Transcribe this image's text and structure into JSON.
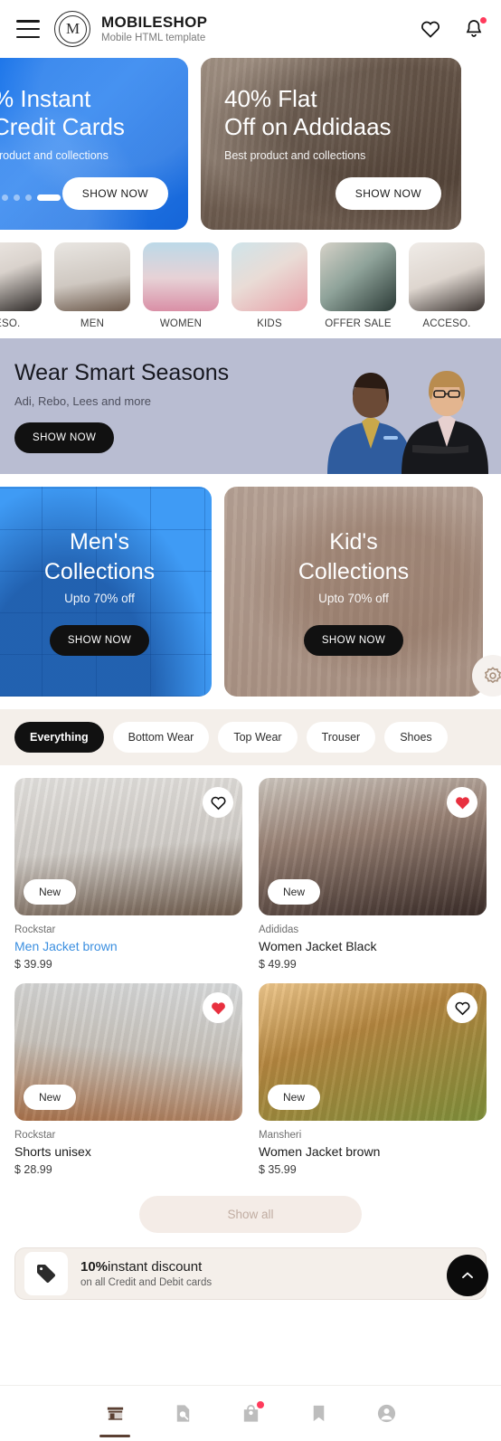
{
  "header": {
    "menu_icon": "hamburger-menu-icon",
    "logo_monogram": "M",
    "title": "MOBILESHOP",
    "subtitle": "Mobile HTML template",
    "wishlist_icon": "heart-icon",
    "notification_icon": "bell-icon",
    "notification_has_badge": true
  },
  "hero": {
    "slides": [
      {
        "title_line1": "% Instant",
        "title_line2": "Credit Cards",
        "subtitle": "product and collections",
        "button": "SHOW NOW",
        "theme": "blue"
      },
      {
        "title_line1": "40% Flat",
        "title_line2": "Off on Addidaas",
        "subtitle": "Best product and collections",
        "button": "SHOW NOW",
        "theme": "tan"
      }
    ],
    "dots_total": 4,
    "dots_active_index": 3
  },
  "categories": [
    {
      "label": "CESO.",
      "image": "accessories-thumb"
    },
    {
      "label": "MEN",
      "image": "men-thumb"
    },
    {
      "label": "WOMEN",
      "image": "women-thumb"
    },
    {
      "label": "KIDS",
      "image": "kids-thumb"
    },
    {
      "label": "OFFER SALE",
      "image": "offer-sale-thumb"
    },
    {
      "label": "ACCESO.",
      "image": "accessories-thumb-2"
    }
  ],
  "wide_banner": {
    "title": "Wear Smart Seasons",
    "subtitle": "Adi, Rebo, Lees and more",
    "button": "SHOW NOW",
    "bg_color": "#b9bdd2"
  },
  "collections": [
    {
      "title_line1": "Men's",
      "title_line2": "Collections",
      "subtitle": "Upto 70% off",
      "button": "SHOW NOW",
      "theme": "blue"
    },
    {
      "title_line1": "Kid's",
      "title_line2": "Collections",
      "subtitle": "Upto 70% off",
      "button": "SHOW NOW",
      "theme": "tan"
    }
  ],
  "settings_fab_icon": "gear-icon",
  "filters": {
    "chips": [
      "Everything",
      "Bottom Wear",
      "Top Wear",
      "Trouser",
      "Shoes"
    ],
    "active_index": 0,
    "bg_color": "#f4efea"
  },
  "products": [
    {
      "brand": "Rockstar",
      "name": "Men Jacket brown",
      "price": "$ 39.99",
      "badge": "New",
      "favorited": false,
      "name_highlighted": true
    },
    {
      "brand": "Adididas",
      "name": "Women Jacket Black",
      "price": "$ 49.99",
      "badge": "New",
      "favorited": true,
      "name_highlighted": false
    },
    {
      "brand": "Rockstar",
      "name": "Shorts unisex",
      "price": "$ 28.99",
      "badge": "New",
      "favorited": true,
      "name_highlighted": false
    },
    {
      "brand": "Mansheri",
      "name": "Women Jacket brown",
      "price": "$ 35.99",
      "badge": "New",
      "favorited": false,
      "name_highlighted": false
    }
  ],
  "show_all": {
    "label": "Show all"
  },
  "promo": {
    "icon": "price-tag-icon",
    "percent": "10%",
    "title_rest": "instant discount",
    "subtitle": "on all Credit and Debit cards"
  },
  "scroll_top_fab": {
    "icon": "chevron-up-icon"
  },
  "bottom_nav": {
    "items": [
      {
        "icon": "store-icon",
        "active": true,
        "badge": false
      },
      {
        "icon": "search-doc-icon",
        "active": false,
        "badge": false
      },
      {
        "icon": "shopping-bag-icon",
        "active": false,
        "badge": true
      },
      {
        "icon": "bookmark-icon",
        "active": false,
        "badge": false
      },
      {
        "icon": "account-icon",
        "active": false,
        "badge": false
      }
    ]
  },
  "colors": {
    "accent_blue": "#3b8fe0",
    "badge_red": "#ff3b5c",
    "favorite_red": "#e8303f",
    "nav_active": "#5b4033",
    "beige": "#f4efea"
  }
}
